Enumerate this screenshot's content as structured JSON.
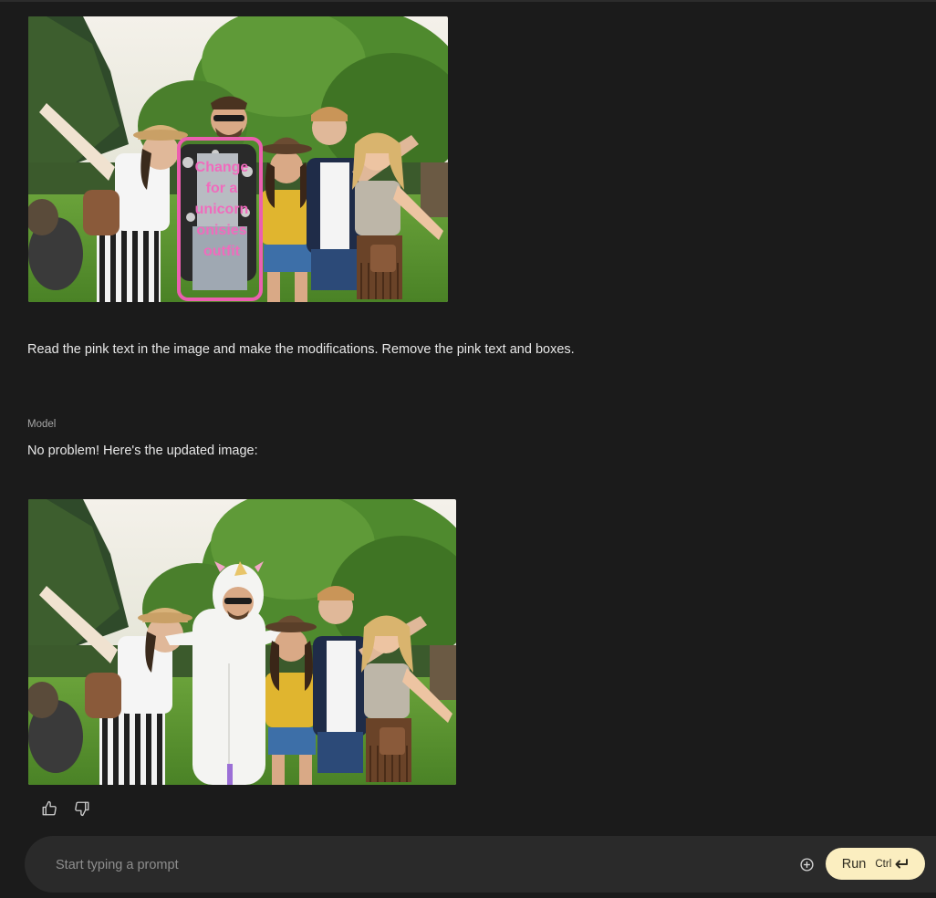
{
  "conversation": {
    "user_image_alt": "Group of five friends at an outdoor festival with a pink box around the man in a floral shirt",
    "user_image_annotation": [
      "Change",
      "for a",
      "unicorn",
      "onisies",
      "outfit"
    ],
    "user_prompt": "Read the pink text in the image and make the modifications. Remove the pink text and boxes.",
    "model_label": "Model",
    "model_reply": "No problem! Here's the updated image:",
    "model_image_alt": "Same group of friends with the man now wearing a white unicorn onesie"
  },
  "feedback": {
    "thumbs_up_icon": "thumbs-up-icon",
    "thumbs_down_icon": "thumbs-down-icon"
  },
  "composer": {
    "placeholder": "Start typing a prompt",
    "value": "",
    "add_icon": "add-circle-icon",
    "run_label": "Run",
    "shortcut_label": "Ctrl",
    "shortcut_icon": "enter-key-icon"
  },
  "colors": {
    "background": "#1b1b1b",
    "composer_bg": "#2a2a2a",
    "run_button": "#fbeec0",
    "annotation_pink": "#ec5fb0"
  }
}
